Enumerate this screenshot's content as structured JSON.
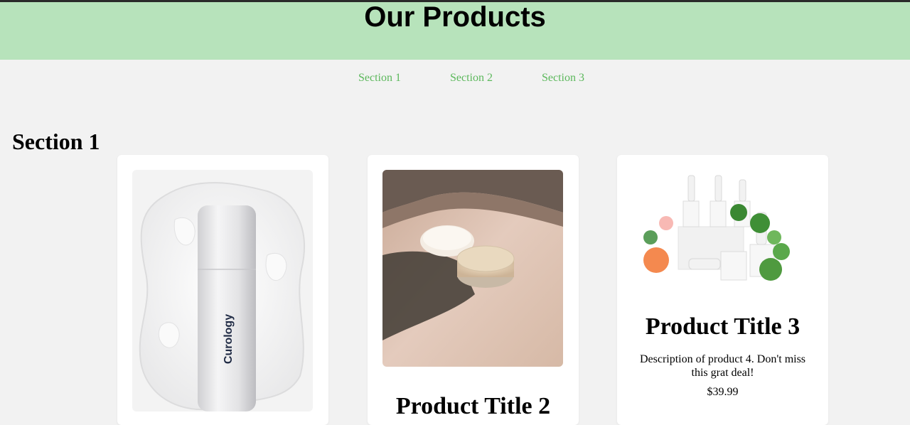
{
  "header": {
    "title": "Our Products"
  },
  "nav": {
    "links": [
      "Section 1",
      "Section 2",
      "Section 3"
    ]
  },
  "section": {
    "title": "Section 1",
    "products": [
      {
        "title": "",
        "description": "",
        "price": "",
        "image_brand_text": "Curology"
      },
      {
        "title": "Product Title 2",
        "description": "",
        "price": ""
      },
      {
        "title": "Product Title 3",
        "description": "Description of product 4. Don't miss this grat deal!",
        "price": "$39.99"
      }
    ]
  },
  "colors": {
    "header_bg": "#b7e3bb",
    "nav_link": "#5cb85c",
    "page_bg": "#f2f2f2"
  }
}
